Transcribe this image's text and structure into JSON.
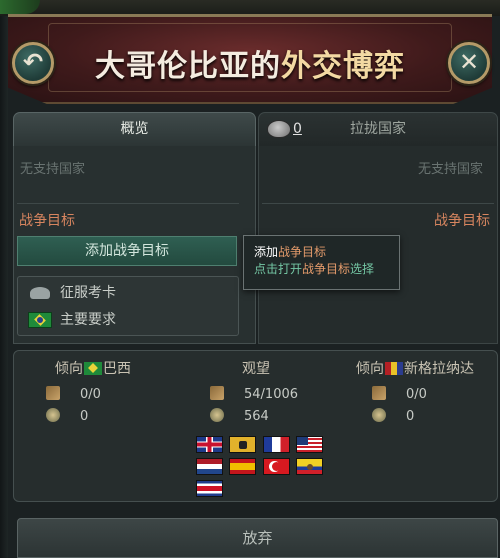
{
  "header": {
    "title_country": "大哥伦比亚的",
    "title_rest": "外交博弈"
  },
  "tabs": {
    "overview": "概览",
    "lobby_count": "0",
    "lobby": "拉拢国家"
  },
  "left": {
    "no_support": "无支持国家",
    "war_goals_label": "战争目标",
    "add_war_goal": "添加战争目标",
    "goals": [
      {
        "icon": "conquer-icon",
        "label": "征服考卡"
      },
      {
        "icon": "brazil-flag-icon",
        "label": "主要要求"
      }
    ]
  },
  "right": {
    "no_support": "无支持国家",
    "war_goals_label": "战争目标"
  },
  "tooltip": {
    "line1_a": "添加",
    "line1_b": "战争目标",
    "line2_a": "点击打开",
    "line2_b": "战争目标",
    "line2_c": "选择"
  },
  "stats": {
    "left": {
      "prefix": "倾向",
      "country": "巴西",
      "soldiers": "0/0",
      "generals": "0"
    },
    "middle": {
      "label": "观望",
      "soldiers": "54/1006",
      "generals": "564",
      "flags": [
        "uk-flag",
        "austria-flag",
        "france-flag",
        "usa-flag",
        "netherlands-flag",
        "spain-flag",
        "turkey-flag",
        "ecuador-flag",
        "costa-rica-flag"
      ]
    },
    "right": {
      "prefix": "倾向",
      "country": "新格拉纳达",
      "soldiers": "0/0",
      "generals": "0"
    }
  },
  "footer": {
    "give_up": "放弃"
  },
  "colors": {
    "accent_orange": "#d7855f",
    "accent_green": "#74c7a4",
    "title_highlight": "#f3d9a3"
  }
}
